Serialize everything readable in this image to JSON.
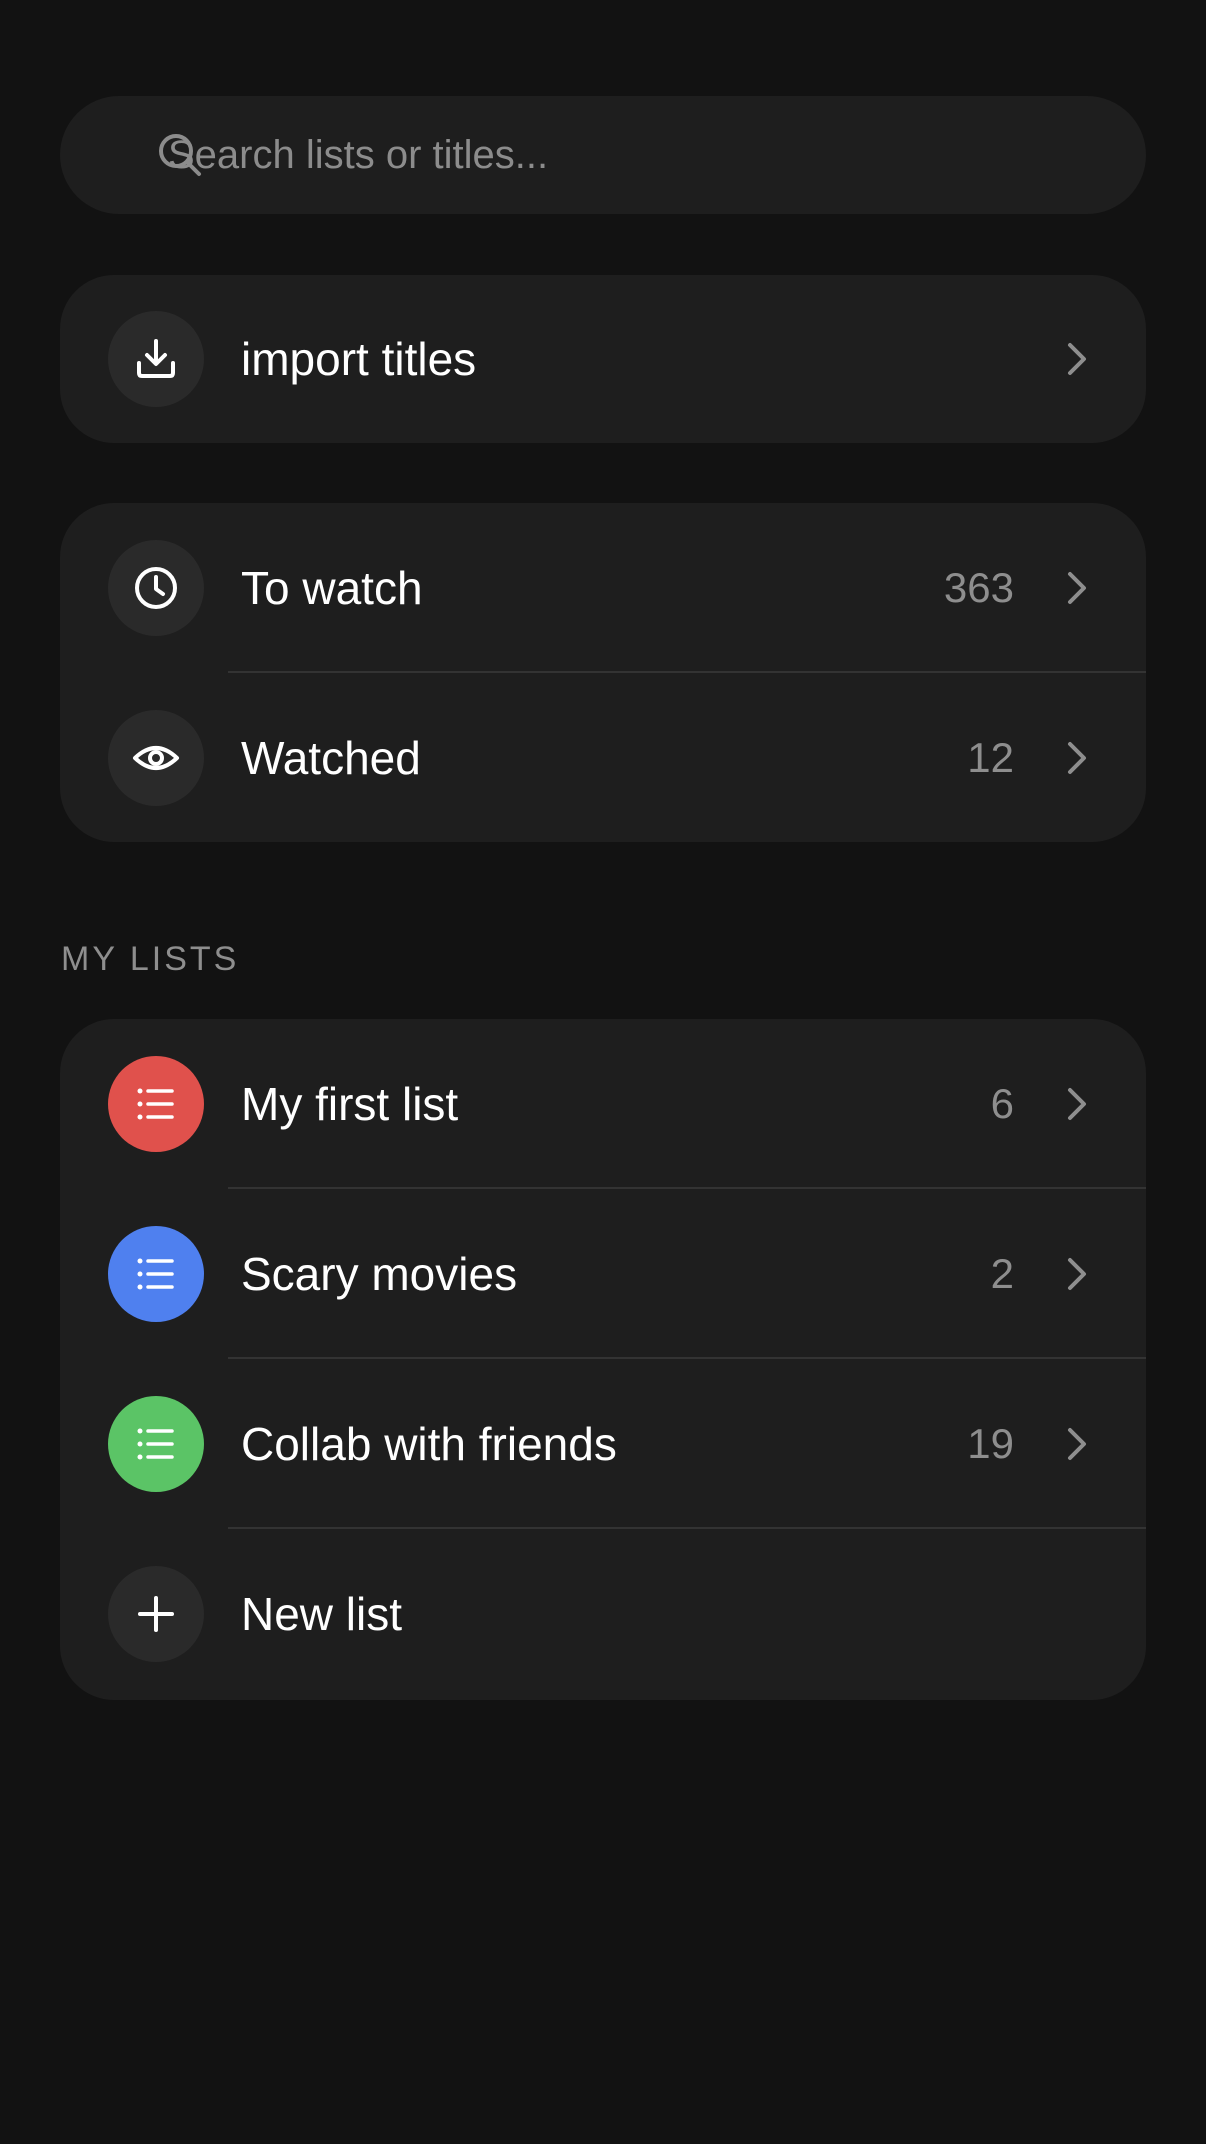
{
  "search": {
    "placeholder": "Search lists or titles..."
  },
  "import": {
    "label": "import titles"
  },
  "status_lists": [
    {
      "label": "To watch",
      "count": "363",
      "icon": "clock-icon"
    },
    {
      "label": "Watched",
      "count": "12",
      "icon": "eye-icon"
    }
  ],
  "my_lists": {
    "section_title": "MY LISTS",
    "items": [
      {
        "label": "My first list",
        "count": "6",
        "color": "#e0514c"
      },
      {
        "label": "Scary movies",
        "count": "2",
        "color": "#4f80ef"
      },
      {
        "label": "Collab with friends",
        "count": "19",
        "color": "#5bc466"
      }
    ],
    "new_list_label": "New list"
  },
  "colors": {
    "background": "#121212",
    "card": "#1e1e1e",
    "icon_circle": "#2a2a2a",
    "muted_text": "#8e8e8e"
  }
}
